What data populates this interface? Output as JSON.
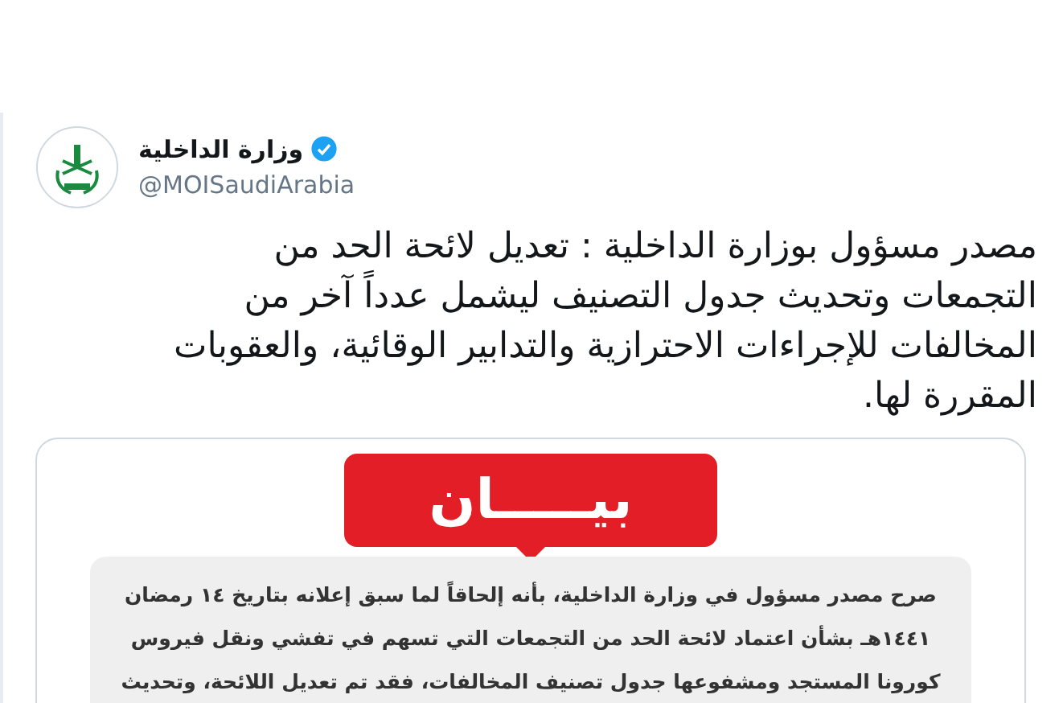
{
  "tweet": {
    "author": {
      "name": "وزارة الداخلية",
      "verified": true,
      "handle": "@MOISaudiArabia"
    },
    "text": "مصدر مسؤول بوزارة الداخلية : تعديل لائحة الحد من التجمعات وتحديث جدول التصنيف ليشمل عدداً آخر من المخالفات للإجراءات الاحترازية والتدابير الوقائية، والعقوبات المقررة لها.",
    "image": {
      "badge": "بيـــــان",
      "lines": [
        "صرح مصدر مسؤول في وزارة الداخلية، بأنه إلحاقاً لما سبق إعلانه بتاريخ ١٤ رمضان",
        "١٤٤١هـ بشأن اعتماد لائحة الحد من التجمعات التي تسهم في تفشي ونقل فيروس",
        "كورونا المستجد ومشفوعها جدول تصنيف المخالفات، فقد تم تعديل اللائحة، وتحديث"
      ]
    }
  }
}
